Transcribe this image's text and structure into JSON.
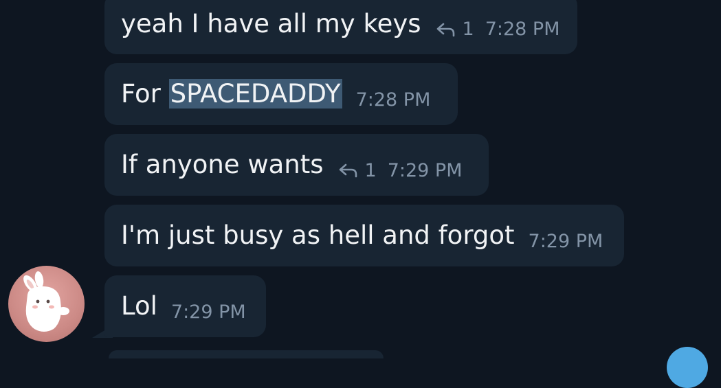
{
  "messages": [
    {
      "text": "yeah I have all my keys",
      "reply_count": "1",
      "time": "7:28 PM"
    },
    {
      "text_prefix": "For ",
      "text_highlight": "SPACEDADDY",
      "time": "7:28 PM"
    },
    {
      "text": "If anyone wants",
      "reply_count": "1",
      "time": "7:29 PM"
    },
    {
      "text": "I'm just busy as hell and forgot",
      "time": "7:29 PM"
    },
    {
      "text": "Lol",
      "time": "7:29 PM"
    }
  ],
  "icons": {
    "reply": "reply-arrow-icon",
    "avatar": "bunny-avatar"
  },
  "colors": {
    "background": "#0e1621",
    "bubble": "#182533",
    "text": "#f1f3f5",
    "meta": "#8394a7",
    "selection": "#3e5a74",
    "accent": "#4fa9e3"
  }
}
